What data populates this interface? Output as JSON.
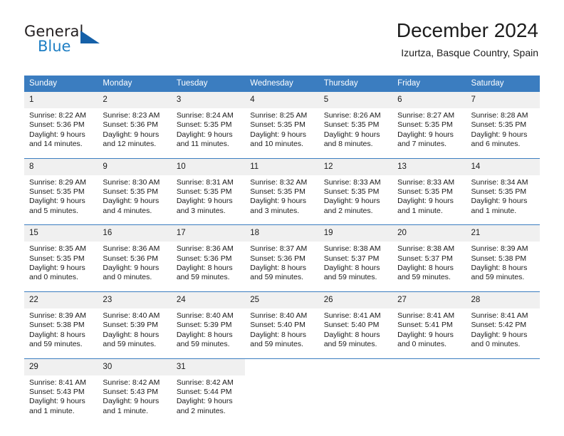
{
  "brand": {
    "name_top": "General",
    "name_bottom": "Blue",
    "accent_color": "#1560a8",
    "text_color": "#231f20"
  },
  "header": {
    "title": "December 2024",
    "location": "Izurtza, Basque Country, Spain"
  },
  "theme": {
    "header_bg": "#3b7dc0",
    "header_text": "#ffffff",
    "daynum_bg": "#f0f0f0",
    "cell_bg": "#ffffff",
    "text": "#1a1a1a"
  },
  "weekdays": [
    "Sunday",
    "Monday",
    "Tuesday",
    "Wednesday",
    "Thursday",
    "Friday",
    "Saturday"
  ],
  "weeks": [
    [
      {
        "day": "1",
        "sunrise": "Sunrise: 8:22 AM",
        "sunset": "Sunset: 5:36 PM",
        "daylight_line1": "Daylight: 9 hours",
        "daylight_line2": "and 14 minutes."
      },
      {
        "day": "2",
        "sunrise": "Sunrise: 8:23 AM",
        "sunset": "Sunset: 5:36 PM",
        "daylight_line1": "Daylight: 9 hours",
        "daylight_line2": "and 12 minutes."
      },
      {
        "day": "3",
        "sunrise": "Sunrise: 8:24 AM",
        "sunset": "Sunset: 5:35 PM",
        "daylight_line1": "Daylight: 9 hours",
        "daylight_line2": "and 11 minutes."
      },
      {
        "day": "4",
        "sunrise": "Sunrise: 8:25 AM",
        "sunset": "Sunset: 5:35 PM",
        "daylight_line1": "Daylight: 9 hours",
        "daylight_line2": "and 10 minutes."
      },
      {
        "day": "5",
        "sunrise": "Sunrise: 8:26 AM",
        "sunset": "Sunset: 5:35 PM",
        "daylight_line1": "Daylight: 9 hours",
        "daylight_line2": "and 8 minutes."
      },
      {
        "day": "6",
        "sunrise": "Sunrise: 8:27 AM",
        "sunset": "Sunset: 5:35 PM",
        "daylight_line1": "Daylight: 9 hours",
        "daylight_line2": "and 7 minutes."
      },
      {
        "day": "7",
        "sunrise": "Sunrise: 8:28 AM",
        "sunset": "Sunset: 5:35 PM",
        "daylight_line1": "Daylight: 9 hours",
        "daylight_line2": "and 6 minutes."
      }
    ],
    [
      {
        "day": "8",
        "sunrise": "Sunrise: 8:29 AM",
        "sunset": "Sunset: 5:35 PM",
        "daylight_line1": "Daylight: 9 hours",
        "daylight_line2": "and 5 minutes."
      },
      {
        "day": "9",
        "sunrise": "Sunrise: 8:30 AM",
        "sunset": "Sunset: 5:35 PM",
        "daylight_line1": "Daylight: 9 hours",
        "daylight_line2": "and 4 minutes."
      },
      {
        "day": "10",
        "sunrise": "Sunrise: 8:31 AM",
        "sunset": "Sunset: 5:35 PM",
        "daylight_line1": "Daylight: 9 hours",
        "daylight_line2": "and 3 minutes."
      },
      {
        "day": "11",
        "sunrise": "Sunrise: 8:32 AM",
        "sunset": "Sunset: 5:35 PM",
        "daylight_line1": "Daylight: 9 hours",
        "daylight_line2": "and 3 minutes."
      },
      {
        "day": "12",
        "sunrise": "Sunrise: 8:33 AM",
        "sunset": "Sunset: 5:35 PM",
        "daylight_line1": "Daylight: 9 hours",
        "daylight_line2": "and 2 minutes."
      },
      {
        "day": "13",
        "sunrise": "Sunrise: 8:33 AM",
        "sunset": "Sunset: 5:35 PM",
        "daylight_line1": "Daylight: 9 hours",
        "daylight_line2": "and 1 minute."
      },
      {
        "day": "14",
        "sunrise": "Sunrise: 8:34 AM",
        "sunset": "Sunset: 5:35 PM",
        "daylight_line1": "Daylight: 9 hours",
        "daylight_line2": "and 1 minute."
      }
    ],
    [
      {
        "day": "15",
        "sunrise": "Sunrise: 8:35 AM",
        "sunset": "Sunset: 5:35 PM",
        "daylight_line1": "Daylight: 9 hours",
        "daylight_line2": "and 0 minutes."
      },
      {
        "day": "16",
        "sunrise": "Sunrise: 8:36 AM",
        "sunset": "Sunset: 5:36 PM",
        "daylight_line1": "Daylight: 9 hours",
        "daylight_line2": "and 0 minutes."
      },
      {
        "day": "17",
        "sunrise": "Sunrise: 8:36 AM",
        "sunset": "Sunset: 5:36 PM",
        "daylight_line1": "Daylight: 8 hours",
        "daylight_line2": "and 59 minutes."
      },
      {
        "day": "18",
        "sunrise": "Sunrise: 8:37 AM",
        "sunset": "Sunset: 5:36 PM",
        "daylight_line1": "Daylight: 8 hours",
        "daylight_line2": "and 59 minutes."
      },
      {
        "day": "19",
        "sunrise": "Sunrise: 8:38 AM",
        "sunset": "Sunset: 5:37 PM",
        "daylight_line1": "Daylight: 8 hours",
        "daylight_line2": "and 59 minutes."
      },
      {
        "day": "20",
        "sunrise": "Sunrise: 8:38 AM",
        "sunset": "Sunset: 5:37 PM",
        "daylight_line1": "Daylight: 8 hours",
        "daylight_line2": "and 59 minutes."
      },
      {
        "day": "21",
        "sunrise": "Sunrise: 8:39 AM",
        "sunset": "Sunset: 5:38 PM",
        "daylight_line1": "Daylight: 8 hours",
        "daylight_line2": "and 59 minutes."
      }
    ],
    [
      {
        "day": "22",
        "sunrise": "Sunrise: 8:39 AM",
        "sunset": "Sunset: 5:38 PM",
        "daylight_line1": "Daylight: 8 hours",
        "daylight_line2": "and 59 minutes."
      },
      {
        "day": "23",
        "sunrise": "Sunrise: 8:40 AM",
        "sunset": "Sunset: 5:39 PM",
        "daylight_line1": "Daylight: 8 hours",
        "daylight_line2": "and 59 minutes."
      },
      {
        "day": "24",
        "sunrise": "Sunrise: 8:40 AM",
        "sunset": "Sunset: 5:39 PM",
        "daylight_line1": "Daylight: 8 hours",
        "daylight_line2": "and 59 minutes."
      },
      {
        "day": "25",
        "sunrise": "Sunrise: 8:40 AM",
        "sunset": "Sunset: 5:40 PM",
        "daylight_line1": "Daylight: 8 hours",
        "daylight_line2": "and 59 minutes."
      },
      {
        "day": "26",
        "sunrise": "Sunrise: 8:41 AM",
        "sunset": "Sunset: 5:40 PM",
        "daylight_line1": "Daylight: 8 hours",
        "daylight_line2": "and 59 minutes."
      },
      {
        "day": "27",
        "sunrise": "Sunrise: 8:41 AM",
        "sunset": "Sunset: 5:41 PM",
        "daylight_line1": "Daylight: 9 hours",
        "daylight_line2": "and 0 minutes."
      },
      {
        "day": "28",
        "sunrise": "Sunrise: 8:41 AM",
        "sunset": "Sunset: 5:42 PM",
        "daylight_line1": "Daylight: 9 hours",
        "daylight_line2": "and 0 minutes."
      }
    ],
    [
      {
        "day": "29",
        "sunrise": "Sunrise: 8:41 AM",
        "sunset": "Sunset: 5:43 PM",
        "daylight_line1": "Daylight: 9 hours",
        "daylight_line2": "and 1 minute."
      },
      {
        "day": "30",
        "sunrise": "Sunrise: 8:42 AM",
        "sunset": "Sunset: 5:43 PM",
        "daylight_line1": "Daylight: 9 hours",
        "daylight_line2": "and 1 minute."
      },
      {
        "day": "31",
        "sunrise": "Sunrise: 8:42 AM",
        "sunset": "Sunset: 5:44 PM",
        "daylight_line1": "Daylight: 9 hours",
        "daylight_line2": "and 2 minutes."
      },
      {
        "day": "",
        "sunrise": "",
        "sunset": "",
        "daylight_line1": "",
        "daylight_line2": ""
      },
      {
        "day": "",
        "sunrise": "",
        "sunset": "",
        "daylight_line1": "",
        "daylight_line2": ""
      },
      {
        "day": "",
        "sunrise": "",
        "sunset": "",
        "daylight_line1": "",
        "daylight_line2": ""
      },
      {
        "day": "",
        "sunrise": "",
        "sunset": "",
        "daylight_line1": "",
        "daylight_line2": ""
      }
    ]
  ]
}
